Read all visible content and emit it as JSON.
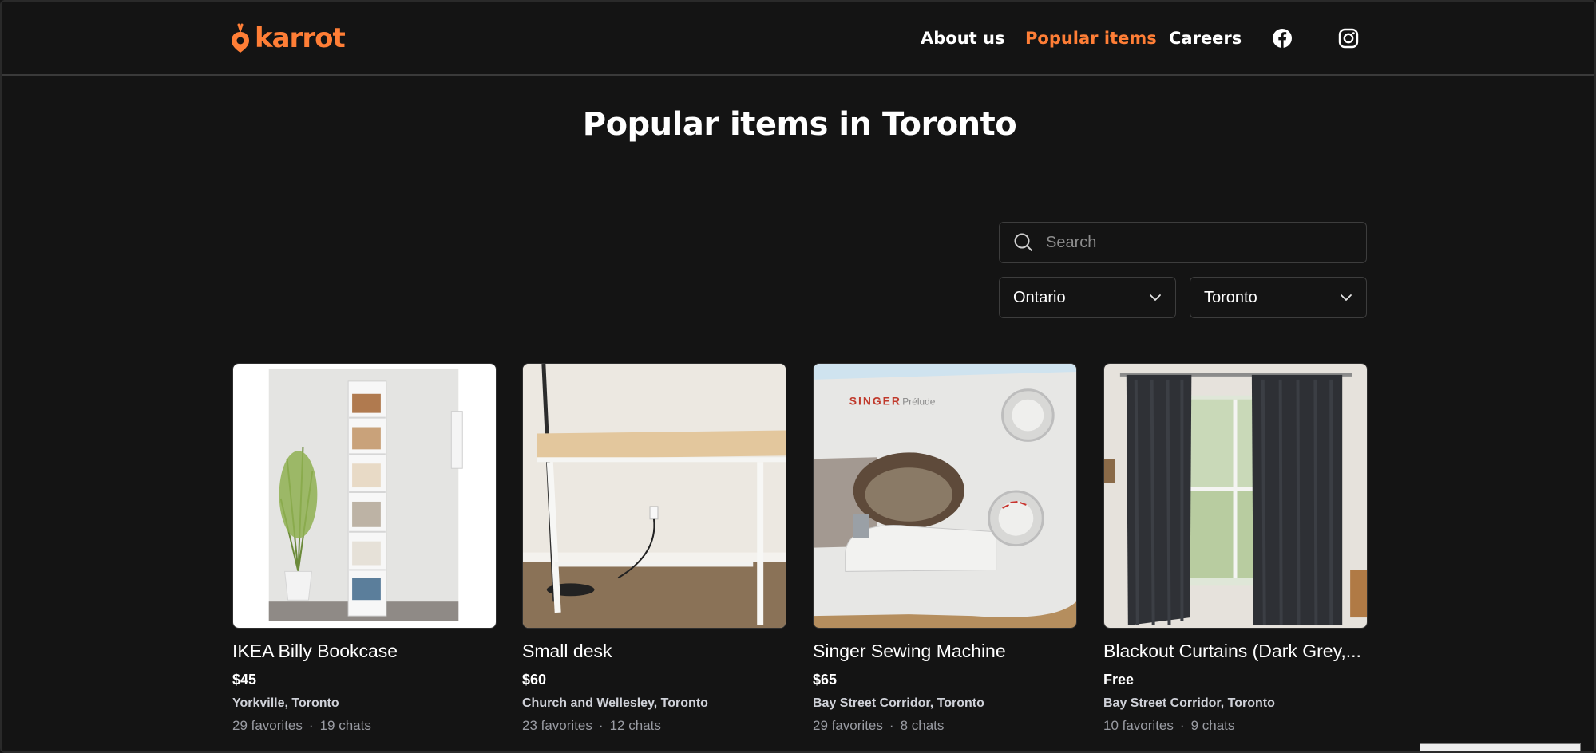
{
  "brand": {
    "name": "karrot",
    "accent_color": "#ff7e36"
  },
  "nav": {
    "about": "About us",
    "popular": "Popular items",
    "careers": "Careers",
    "facebook_icon": "facebook-icon",
    "instagram_icon": "instagram-icon"
  },
  "page": {
    "title": "Popular items in Toronto"
  },
  "search": {
    "placeholder": "Search",
    "value": ""
  },
  "filters": {
    "province": "Ontario",
    "city": "Toronto"
  },
  "items": [
    {
      "title": "IKEA Billy Bookcase",
      "price": "$45",
      "location": "Yorkville, Toronto",
      "favorites": "29 favorites",
      "chats": "19 chats",
      "image": "bookcase-photo"
    },
    {
      "title": "Small desk",
      "price": "$60",
      "location": "Church and Wellesley, Toronto",
      "favorites": "23 favorites",
      "chats": "12 chats",
      "image": "desk-photo"
    },
    {
      "title": "Singer Sewing Machine",
      "price": "$65",
      "location": "Bay Street Corridor, Toronto",
      "favorites": "29 favorites",
      "chats": "8 chats",
      "image": "sewing-machine-photo"
    },
    {
      "title": "Blackout Curtains (Dark Grey,...",
      "price": "Free",
      "location": "Bay Street Corridor, Toronto",
      "favorites": "10 favorites",
      "chats": "9 chats",
      "image": "curtains-photo"
    }
  ],
  "image_photo_labels": {
    "sewing_machine_brand": "SINGER",
    "sewing_machine_model": "Prélude"
  }
}
